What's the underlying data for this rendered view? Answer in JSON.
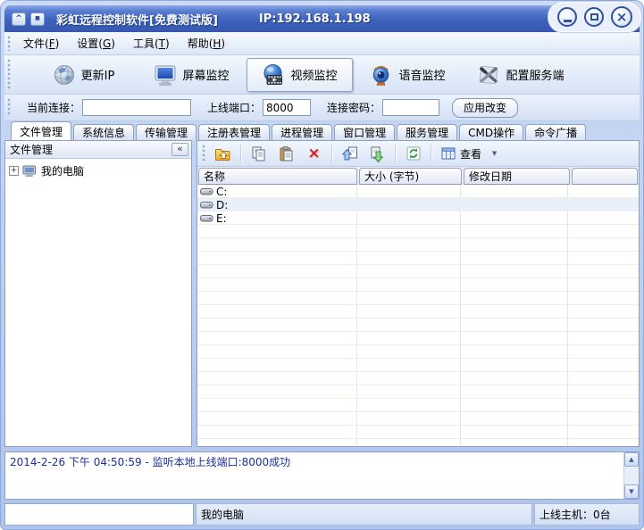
{
  "window": {
    "title": "彩虹远程控制软件[免费测试版]",
    "ip": "IP:192.168.1.198"
  },
  "icons": {
    "rollup": "^",
    "tray": "■",
    "close": "×",
    "collapse": "«",
    "delete": "×",
    "dropdown": "▼",
    "scroll_up": "▲",
    "scroll_down": "▼"
  },
  "menu": {
    "items": [
      {
        "pre": "文件(",
        "key": "F",
        "post": ")"
      },
      {
        "pre": "设置(",
        "key": "G",
        "post": ")"
      },
      {
        "pre": "工具(",
        "key": "T",
        "post": ")"
      },
      {
        "pre": "帮助(",
        "key": "H",
        "post": ")"
      }
    ]
  },
  "main_toolbar": {
    "buttons": [
      {
        "label": "更新IP",
        "icon": "globe-icon",
        "active": false
      },
      {
        "label": "屏幕监控",
        "icon": "monitor-icon",
        "active": false
      },
      {
        "label": "视频监控",
        "icon": "video-icon",
        "active": true
      },
      {
        "label": "语音监控",
        "icon": "webcam-icon",
        "active": false
      },
      {
        "label": "配置服务端",
        "icon": "server-config-icon",
        "active": false
      }
    ]
  },
  "connection_bar": {
    "current_label": "当前连接：",
    "current_value": "",
    "port_label": "上线端口：",
    "port_value": "8000",
    "password_label": "连接密码：",
    "password_value": "",
    "apply_label": "应用改变"
  },
  "tabs": [
    "文件管理",
    "系统信息",
    "传输管理",
    "注册表管理",
    "进程管理",
    "窗口管理",
    "服务管理",
    "CMD操作",
    "命令广播"
  ],
  "left_panel": {
    "header": "文件管理",
    "tree_items": [
      {
        "label": "我的电脑",
        "expander": "+"
      }
    ]
  },
  "file_toolbar": {
    "view_label": "查看"
  },
  "file_table": {
    "columns": [
      "名称",
      "大小 (字节)",
      "修改日期",
      ""
    ],
    "rows": [
      {
        "name": "C:",
        "size": "",
        "date": ""
      },
      {
        "name": "D:",
        "size": "",
        "date": ""
      },
      {
        "name": "E:",
        "size": "",
        "date": ""
      }
    ]
  },
  "log": {
    "entries": [
      "2014-2-26 下午 04:50:59 - 监听本地上线端口:8000成功"
    ]
  },
  "status_bar": {
    "left_value": "",
    "computer": "我的电脑",
    "online_hosts": "上线主机：0台"
  },
  "colors": {
    "titlebar_blue": "#3D63BE",
    "frame_blue": "#AFC5EE",
    "log_text": "#1B2F9E",
    "row_alt": "#E9F0FA"
  }
}
